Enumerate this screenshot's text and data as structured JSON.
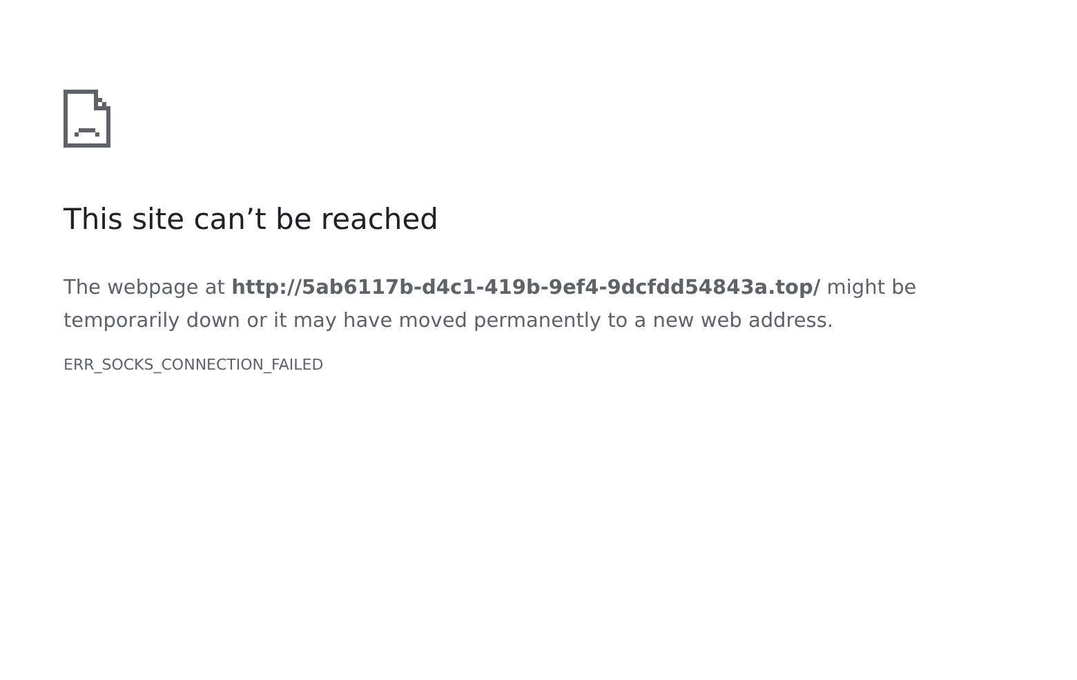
{
  "heading": "This site can’t be reached",
  "message": "The webpage at **http://5ab6117b-d4c1-419b-9ef4-9dcfdd54843a.top/** might be temporarily down or it may have moved permanently to a new web address.",
  "error_code": "ERR_SOCKS_CONNECTION_FAILED"
}
